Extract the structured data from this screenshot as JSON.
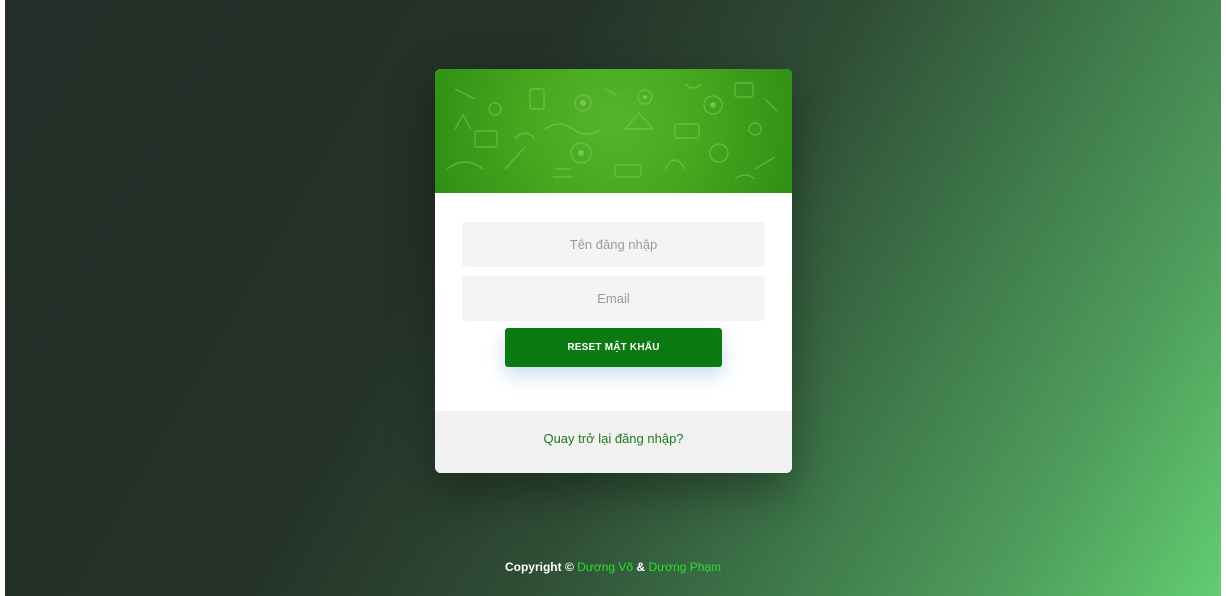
{
  "form": {
    "username_placeholder": "Tên đăng nhập",
    "email_placeholder": "Email",
    "username_value": "",
    "email_value": "",
    "reset_button_label": "RESET MẬT KHẨU"
  },
  "footer": {
    "back_link": "Quay trở lại đăng nhập?"
  },
  "copyright": {
    "prefix": "Copyright ©",
    "author1": "Dương Võ",
    "separator": "&",
    "author2": "Dương Phạm"
  },
  "colors": {
    "header_green": "#47a71f",
    "button_green": "#0c7a13",
    "link_green": "#1b7a1b",
    "author_green": "#29e129"
  },
  "icons": {
    "header_pattern": "education-doodle-pattern"
  }
}
